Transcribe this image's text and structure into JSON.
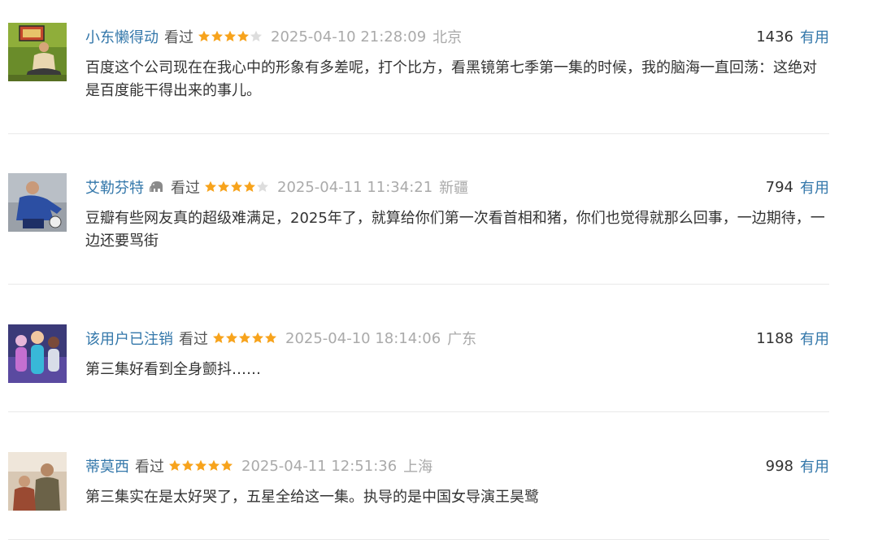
{
  "colors": {
    "link": "#3377aa",
    "star_full": "#f7a31c",
    "star_empty": "#dddddd",
    "muted": "#aaaaaa",
    "divider": "#e9e9e9"
  },
  "comments": [
    {
      "user": "小东懒得动",
      "watched": "看过",
      "rating": 4,
      "time": "2025-04-10 21:28:09",
      "location": "北京",
      "votes": "1436",
      "useful": "有用",
      "text": "百度这个公司现在在我心中的形象有多差呢，打个比方，看黑镜第七季第一集的时候，我的脑海一直回荡：这绝对是百度能干得出来的事儿。",
      "avatar_icon": "person-sitting-photo"
    },
    {
      "user": "艾勒芬特",
      "watched": "看过",
      "rating": 4,
      "time": "2025-04-11 11:34:21",
      "location": "新疆",
      "votes": "794",
      "useful": "有用",
      "text": "豆瓣有些网友真的超级难满足，2025年了，就算给你们第一次看首相和猪，你们也觉得就那么回事，一边期待，一边还要骂街",
      "avatar_icon": "football-player-photo",
      "badge_icon": "elephant-icon"
    },
    {
      "user": "该用户已注销",
      "watched": "看过",
      "rating": 5,
      "time": "2025-04-10 18:14:06",
      "location": "广东",
      "votes": "1188",
      "useful": "有用",
      "text": "第三集好看到全身颤抖……",
      "avatar_icon": "animated-characters-photo"
    },
    {
      "user": "蒂莫西",
      "watched": "看过",
      "rating": 5,
      "time": "2025-04-11 12:51:36",
      "location": "上海",
      "votes": "998",
      "useful": "有用",
      "text": "第三集实在是太好哭了，五星全给这一集。执导的是中国女导演王昊鹭",
      "avatar_icon": "people-photo"
    }
  ]
}
